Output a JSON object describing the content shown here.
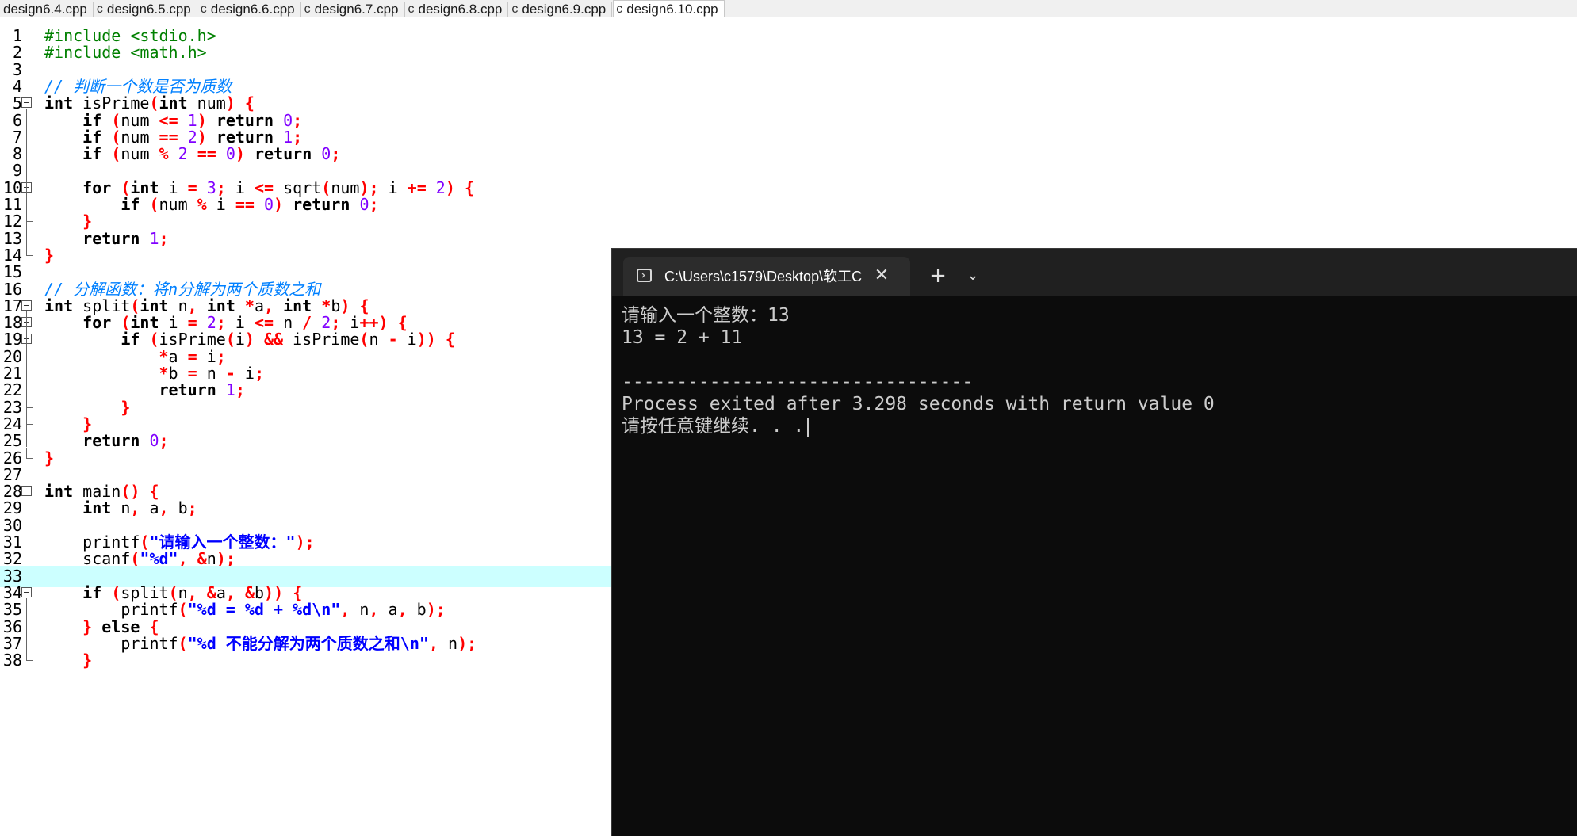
{
  "editor_tabs": [
    {
      "icon": "c",
      "label": "design6.4.cpp",
      "active": false
    },
    {
      "icon": "c",
      "label": "design6.5.cpp",
      "active": false
    },
    {
      "icon": "c",
      "label": "design6.6.cpp",
      "active": false
    },
    {
      "icon": "c",
      "label": "design6.7.cpp",
      "active": false
    },
    {
      "icon": "c",
      "label": "design6.8.cpp",
      "active": false
    },
    {
      "icon": "c",
      "label": "design6.9.cpp",
      "active": false
    },
    {
      "icon": "c",
      "label": "design6.10.cpp",
      "active": true
    }
  ],
  "code_lines": [
    {
      "n": "1",
      "tokens": [
        [
          "pp",
          "#include <stdio.h>"
        ]
      ]
    },
    {
      "n": "2",
      "tokens": [
        [
          "pp",
          "#include <math.h>"
        ]
      ]
    },
    {
      "n": "3",
      "tokens": []
    },
    {
      "n": "4",
      "tokens": [
        [
          "cm",
          "// 判断一个数是否为质数"
        ]
      ]
    },
    {
      "n": "5",
      "fold": "open",
      "tokens": [
        [
          "kw",
          "int"
        ],
        [
          "id",
          " isPrime"
        ],
        [
          "sym",
          "("
        ],
        [
          "kw",
          "int"
        ],
        [
          "id",
          " num"
        ],
        [
          "sym",
          ")"
        ],
        [
          "id",
          " "
        ],
        [
          "sym",
          "{"
        ]
      ]
    },
    {
      "n": "6",
      "tokens": [
        [
          "id",
          "    "
        ],
        [
          "kw",
          "if"
        ],
        [
          "id",
          " "
        ],
        [
          "sym",
          "("
        ],
        [
          "id",
          "num "
        ],
        [
          "sym",
          "<="
        ],
        [
          "id",
          " "
        ],
        [
          "num",
          "1"
        ],
        [
          "sym",
          ")"
        ],
        [
          "id",
          " "
        ],
        [
          "kw",
          "return"
        ],
        [
          "id",
          " "
        ],
        [
          "num",
          "0"
        ],
        [
          "sym",
          ";"
        ]
      ]
    },
    {
      "n": "7",
      "tokens": [
        [
          "id",
          "    "
        ],
        [
          "kw",
          "if"
        ],
        [
          "id",
          " "
        ],
        [
          "sym",
          "("
        ],
        [
          "id",
          "num "
        ],
        [
          "sym",
          "=="
        ],
        [
          "id",
          " "
        ],
        [
          "num",
          "2"
        ],
        [
          "sym",
          ")"
        ],
        [
          "id",
          " "
        ],
        [
          "kw",
          "return"
        ],
        [
          "id",
          " "
        ],
        [
          "num",
          "1"
        ],
        [
          "sym",
          ";"
        ]
      ]
    },
    {
      "n": "8",
      "tokens": [
        [
          "id",
          "    "
        ],
        [
          "kw",
          "if"
        ],
        [
          "id",
          " "
        ],
        [
          "sym",
          "("
        ],
        [
          "id",
          "num "
        ],
        [
          "sym",
          "%"
        ],
        [
          "id",
          " "
        ],
        [
          "num",
          "2"
        ],
        [
          "id",
          " "
        ],
        [
          "sym",
          "=="
        ],
        [
          "id",
          " "
        ],
        [
          "num",
          "0"
        ],
        [
          "sym",
          ")"
        ],
        [
          "id",
          " "
        ],
        [
          "kw",
          "return"
        ],
        [
          "id",
          " "
        ],
        [
          "num",
          "0"
        ],
        [
          "sym",
          ";"
        ]
      ]
    },
    {
      "n": "9",
      "tokens": []
    },
    {
      "n": "10",
      "fold": "open",
      "tokens": [
        [
          "id",
          "    "
        ],
        [
          "kw",
          "for"
        ],
        [
          "id",
          " "
        ],
        [
          "sym",
          "("
        ],
        [
          "kw",
          "int"
        ],
        [
          "id",
          " i "
        ],
        [
          "sym",
          "="
        ],
        [
          "id",
          " "
        ],
        [
          "num",
          "3"
        ],
        [
          "sym",
          ";"
        ],
        [
          "id",
          " i "
        ],
        [
          "sym",
          "<="
        ],
        [
          "id",
          " sqrt"
        ],
        [
          "sym",
          "("
        ],
        [
          "id",
          "num"
        ],
        [
          "sym",
          ");"
        ],
        [
          "id",
          " i "
        ],
        [
          "sym",
          "+="
        ],
        [
          "id",
          " "
        ],
        [
          "num",
          "2"
        ],
        [
          "sym",
          ")"
        ],
        [
          "id",
          " "
        ],
        [
          "sym",
          "{"
        ]
      ]
    },
    {
      "n": "11",
      "tokens": [
        [
          "id",
          "        "
        ],
        [
          "kw",
          "if"
        ],
        [
          "id",
          " "
        ],
        [
          "sym",
          "("
        ],
        [
          "id",
          "num "
        ],
        [
          "sym",
          "%"
        ],
        [
          "id",
          " i "
        ],
        [
          "sym",
          "=="
        ],
        [
          "id",
          " "
        ],
        [
          "num",
          "0"
        ],
        [
          "sym",
          ")"
        ],
        [
          "id",
          " "
        ],
        [
          "kw",
          "return"
        ],
        [
          "id",
          " "
        ],
        [
          "num",
          "0"
        ],
        [
          "sym",
          ";"
        ]
      ]
    },
    {
      "n": "12",
      "fold": "end",
      "tokens": [
        [
          "id",
          "    "
        ],
        [
          "sym",
          "}"
        ]
      ]
    },
    {
      "n": "13",
      "tokens": [
        [
          "id",
          "    "
        ],
        [
          "kw",
          "return"
        ],
        [
          "id",
          " "
        ],
        [
          "num",
          "1"
        ],
        [
          "sym",
          ";"
        ]
      ]
    },
    {
      "n": "14",
      "fold": "end",
      "tokens": [
        [
          "sym",
          "}"
        ]
      ]
    },
    {
      "n": "15",
      "tokens": []
    },
    {
      "n": "16",
      "tokens": [
        [
          "cm",
          "// 分解函数：将n分解为两个质数之和"
        ]
      ]
    },
    {
      "n": "17",
      "fold": "open",
      "tokens": [
        [
          "kw",
          "int"
        ],
        [
          "id",
          " split"
        ],
        [
          "sym",
          "("
        ],
        [
          "kw",
          "int"
        ],
        [
          "id",
          " n"
        ],
        [
          "sym",
          ","
        ],
        [
          "id",
          " "
        ],
        [
          "kw",
          "int"
        ],
        [
          "id",
          " "
        ],
        [
          "sym",
          "*"
        ],
        [
          "id",
          "a"
        ],
        [
          "sym",
          ","
        ],
        [
          "id",
          " "
        ],
        [
          "kw",
          "int"
        ],
        [
          "id",
          " "
        ],
        [
          "sym",
          "*"
        ],
        [
          "id",
          "b"
        ],
        [
          "sym",
          ")"
        ],
        [
          "id",
          " "
        ],
        [
          "sym",
          "{"
        ]
      ]
    },
    {
      "n": "18",
      "fold": "open",
      "tokens": [
        [
          "id",
          "    "
        ],
        [
          "kw",
          "for"
        ],
        [
          "id",
          " "
        ],
        [
          "sym",
          "("
        ],
        [
          "kw",
          "int"
        ],
        [
          "id",
          " i "
        ],
        [
          "sym",
          "="
        ],
        [
          "id",
          " "
        ],
        [
          "num",
          "2"
        ],
        [
          "sym",
          ";"
        ],
        [
          "id",
          " i "
        ],
        [
          "sym",
          "<="
        ],
        [
          "id",
          " n "
        ],
        [
          "sym",
          "/"
        ],
        [
          "id",
          " "
        ],
        [
          "num",
          "2"
        ],
        [
          "sym",
          ";"
        ],
        [
          "id",
          " i"
        ],
        [
          "sym",
          "++)"
        ],
        [
          "id",
          " "
        ],
        [
          "sym",
          "{"
        ]
      ]
    },
    {
      "n": "19",
      "fold": "open",
      "tokens": [
        [
          "id",
          "        "
        ],
        [
          "kw",
          "if"
        ],
        [
          "id",
          " "
        ],
        [
          "sym",
          "("
        ],
        [
          "id",
          "isPrime"
        ],
        [
          "sym",
          "("
        ],
        [
          "id",
          "i"
        ],
        [
          "sym",
          ")"
        ],
        [
          "id",
          " "
        ],
        [
          "sym",
          "&&"
        ],
        [
          "id",
          " isPrime"
        ],
        [
          "sym",
          "("
        ],
        [
          "id",
          "n "
        ],
        [
          "sym",
          "-"
        ],
        [
          "id",
          " i"
        ],
        [
          "sym",
          "))"
        ],
        [
          "id",
          " "
        ],
        [
          "sym",
          "{"
        ]
      ]
    },
    {
      "n": "20",
      "tokens": [
        [
          "id",
          "            "
        ],
        [
          "sym",
          "*"
        ],
        [
          "id",
          "a "
        ],
        [
          "sym",
          "="
        ],
        [
          "id",
          " i"
        ],
        [
          "sym",
          ";"
        ]
      ]
    },
    {
      "n": "21",
      "tokens": [
        [
          "id",
          "            "
        ],
        [
          "sym",
          "*"
        ],
        [
          "id",
          "b "
        ],
        [
          "sym",
          "="
        ],
        [
          "id",
          " n "
        ],
        [
          "sym",
          "-"
        ],
        [
          "id",
          " i"
        ],
        [
          "sym",
          ";"
        ]
      ]
    },
    {
      "n": "22",
      "tokens": [
        [
          "id",
          "            "
        ],
        [
          "kw",
          "return"
        ],
        [
          "id",
          " "
        ],
        [
          "num",
          "1"
        ],
        [
          "sym",
          ";"
        ]
      ]
    },
    {
      "n": "23",
      "fold": "end",
      "tokens": [
        [
          "id",
          "        "
        ],
        [
          "sym",
          "}"
        ]
      ]
    },
    {
      "n": "24",
      "fold": "end",
      "tokens": [
        [
          "id",
          "    "
        ],
        [
          "sym",
          "}"
        ]
      ]
    },
    {
      "n": "25",
      "tokens": [
        [
          "id",
          "    "
        ],
        [
          "kw",
          "return"
        ],
        [
          "id",
          " "
        ],
        [
          "num",
          "0"
        ],
        [
          "sym",
          ";"
        ]
      ]
    },
    {
      "n": "26",
      "fold": "end",
      "tokens": [
        [
          "sym",
          "}"
        ]
      ]
    },
    {
      "n": "27",
      "tokens": []
    },
    {
      "n": "28",
      "fold": "open",
      "tokens": [
        [
          "kw",
          "int"
        ],
        [
          "id",
          " main"
        ],
        [
          "sym",
          "()"
        ],
        [
          "id",
          " "
        ],
        [
          "sym",
          "{"
        ]
      ]
    },
    {
      "n": "29",
      "tokens": [
        [
          "id",
          "    "
        ],
        [
          "kw",
          "int"
        ],
        [
          "id",
          " n"
        ],
        [
          "sym",
          ","
        ],
        [
          "id",
          " a"
        ],
        [
          "sym",
          ","
        ],
        [
          "id",
          " b"
        ],
        [
          "sym",
          ";"
        ]
      ]
    },
    {
      "n": "30",
      "tokens": []
    },
    {
      "n": "31",
      "tokens": [
        [
          "id",
          "    printf"
        ],
        [
          "sym",
          "("
        ],
        [
          "str",
          "\"请输入一个整数：\""
        ],
        [
          "sym",
          ");"
        ]
      ]
    },
    {
      "n": "32",
      "tokens": [
        [
          "id",
          "    scanf"
        ],
        [
          "sym",
          "("
        ],
        [
          "str",
          "\"%d\""
        ],
        [
          "sym",
          ","
        ],
        [
          "id",
          " "
        ],
        [
          "sym",
          "&"
        ],
        [
          "id",
          "n"
        ],
        [
          "sym",
          ");"
        ]
      ]
    },
    {
      "n": "33",
      "highlight": true,
      "tokens": []
    },
    {
      "n": "34",
      "fold": "open",
      "tokens": [
        [
          "id",
          "    "
        ],
        [
          "kw",
          "if"
        ],
        [
          "id",
          " "
        ],
        [
          "sym",
          "("
        ],
        [
          "id",
          "split"
        ],
        [
          "sym",
          "("
        ],
        [
          "id",
          "n"
        ],
        [
          "sym",
          ","
        ],
        [
          "id",
          " "
        ],
        [
          "sym",
          "&"
        ],
        [
          "id",
          "a"
        ],
        [
          "sym",
          ","
        ],
        [
          "id",
          " "
        ],
        [
          "sym",
          "&"
        ],
        [
          "id",
          "b"
        ],
        [
          "sym",
          "))"
        ],
        [
          "id",
          " "
        ],
        [
          "sym",
          "{"
        ]
      ]
    },
    {
      "n": "35",
      "tokens": [
        [
          "id",
          "        printf"
        ],
        [
          "sym",
          "("
        ],
        [
          "str",
          "\"%d = %d + %d\\n\""
        ],
        [
          "sym",
          ","
        ],
        [
          "id",
          " n"
        ],
        [
          "sym",
          ","
        ],
        [
          "id",
          " a"
        ],
        [
          "sym",
          ","
        ],
        [
          "id",
          " b"
        ],
        [
          "sym",
          ");"
        ]
      ]
    },
    {
      "n": "36",
      "fold": "mid",
      "tokens": [
        [
          "id",
          "    "
        ],
        [
          "sym",
          "}"
        ],
        [
          "id",
          " "
        ],
        [
          "kw",
          "else"
        ],
        [
          "id",
          " "
        ],
        [
          "sym",
          "{"
        ]
      ]
    },
    {
      "n": "37",
      "tokens": [
        [
          "id",
          "        printf"
        ],
        [
          "sym",
          "("
        ],
        [
          "str",
          "\"%d 不能分解为两个质数之和\\n\""
        ],
        [
          "sym",
          ","
        ],
        [
          "id",
          " n"
        ],
        [
          "sym",
          ");"
        ]
      ]
    },
    {
      "n": "38",
      "fold": "end",
      "tokens": [
        [
          "id",
          "    "
        ],
        [
          "sym",
          "}"
        ]
      ]
    }
  ],
  "terminal": {
    "tab_title": "C:\\Users\\c1579\\Desktop\\软工C",
    "tab_icon": "terminal-icon",
    "close_glyph": "✕",
    "new_tab_glyph": "+",
    "dropdown_glyph": "⌄",
    "output_lines": [
      "请输入一个整数：13",
      "13 = 2 + 11",
      "",
      "--------------------------------",
      "Process exited after 3.298 seconds with return value 0",
      "请按任意键继续. . ."
    ]
  },
  "colors": {
    "keyword": "#000000",
    "preprocessor": "#008000",
    "comment": "#0080ff",
    "number": "#8000ff",
    "symbol": "#ff0000",
    "string": "#0000ff",
    "current_line": "#ccffff",
    "terminal_bg": "#0c0c0c",
    "terminal_text": "#cccccc"
  }
}
